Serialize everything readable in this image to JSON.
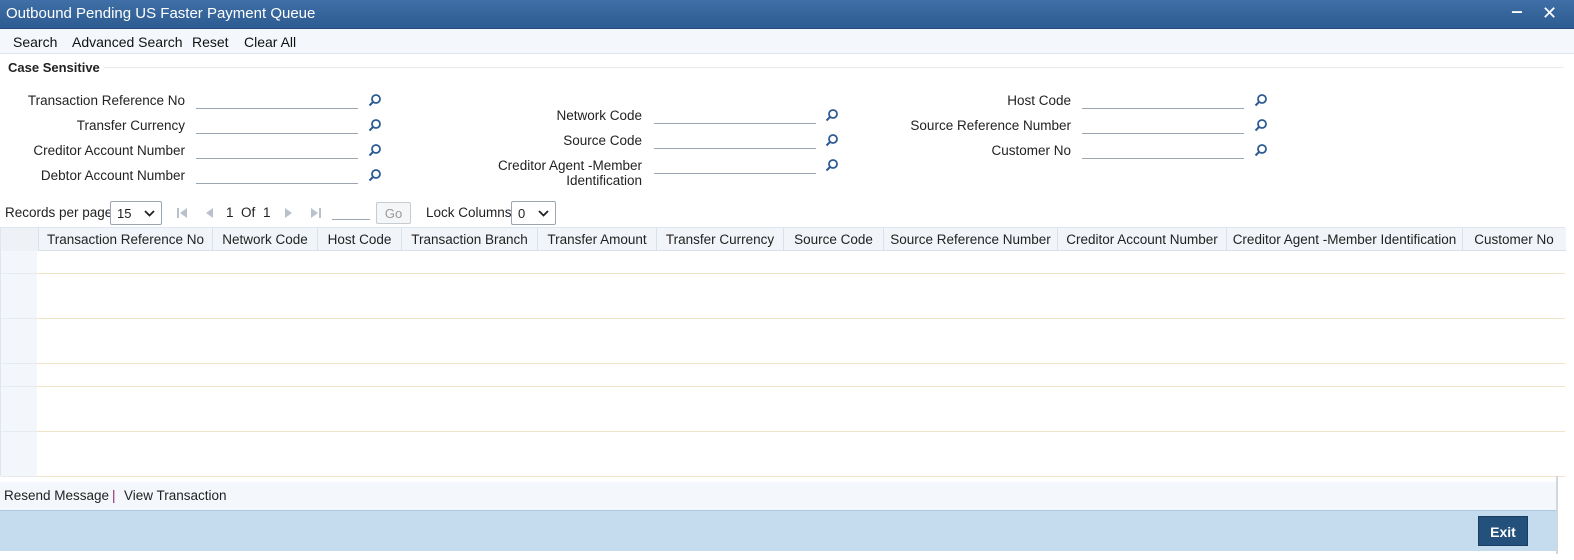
{
  "window": {
    "title": "Outbound Pending US Faster Payment Queue",
    "minimize_glyph": "‒",
    "close_glyph": "✕"
  },
  "menu": {
    "search": "Search",
    "advanced_search": "Advanced Search",
    "reset": "Reset",
    "clear_all": "Clear All"
  },
  "criteria": {
    "section_title": "Case Sensitive",
    "fields": {
      "transaction_reference_no": {
        "label": "Transaction Reference No",
        "value": ""
      },
      "transfer_currency": {
        "label": "Transfer Currency",
        "value": ""
      },
      "creditor_account_number": {
        "label": "Creditor Account Number",
        "value": ""
      },
      "debtor_account_number": {
        "label": "Debtor Account Number",
        "value": ""
      },
      "network_code": {
        "label": "Network Code",
        "value": ""
      },
      "source_code": {
        "label": "Source Code",
        "value": ""
      },
      "creditor_agent_member_identification": {
        "label": "Creditor Agent -Member Identification",
        "value": ""
      },
      "host_code": {
        "label": "Host Code",
        "value": ""
      },
      "source_reference_number": {
        "label": "Source Reference Number",
        "value": ""
      },
      "customer_no": {
        "label": "Customer No",
        "value": ""
      }
    }
  },
  "pager": {
    "records_per_page_label": "Records per page",
    "records_per_page_value": "15",
    "current_page": "1",
    "of_label": "Of",
    "total_pages": "1",
    "go_label": "Go",
    "lock_columns_label": "Lock Columns",
    "lock_columns_value": "0"
  },
  "grid": {
    "columns": [
      "Transaction Reference No",
      "Network Code",
      "Host Code",
      "Transaction Branch",
      "Transfer Amount",
      "Transfer Currency",
      "Source Code",
      "Source Reference Number",
      "Creditor Account Number",
      "Creditor Agent -Member Identification",
      "Customer No"
    ],
    "row_count": 10
  },
  "actions": {
    "resend_message": "Resend Message",
    "separator": "|",
    "view_transaction": "View Transaction"
  },
  "footer": {
    "exit": "Exit"
  },
  "colors": {
    "titlebar": "#2d5b92",
    "footer": "#c5dcef",
    "exit_button": "#24507c"
  }
}
